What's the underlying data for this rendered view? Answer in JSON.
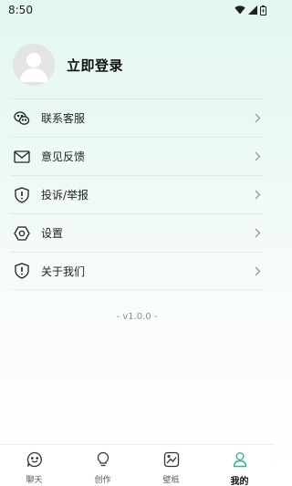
{
  "status_bar": {
    "time": "8:50"
  },
  "profile": {
    "login_label": "立即登录"
  },
  "menu": {
    "items": [
      {
        "label": "联系客服",
        "icon": "wechat-icon"
      },
      {
        "label": "意见反馈",
        "icon": "mail-icon"
      },
      {
        "label": "投诉/举报",
        "icon": "report-shield-icon"
      },
      {
        "label": "设置",
        "icon": "settings-hexagon-icon"
      },
      {
        "label": "关于我们",
        "icon": "about-shield-icon"
      }
    ]
  },
  "version": "- v1.0.0 -",
  "tabbar": {
    "items": [
      {
        "label": "聊天",
        "icon": "chat-smile-icon",
        "active": false
      },
      {
        "label": "创作",
        "icon": "lightbulb-icon",
        "active": false
      },
      {
        "label": "壁纸",
        "icon": "wallpaper-icon",
        "active": false
      },
      {
        "label": "我的",
        "icon": "user-icon",
        "active": true
      }
    ]
  },
  "colors": {
    "accent": "#2bb58a",
    "background_top": "#e3f7f1",
    "text": "#1a1a1a"
  }
}
